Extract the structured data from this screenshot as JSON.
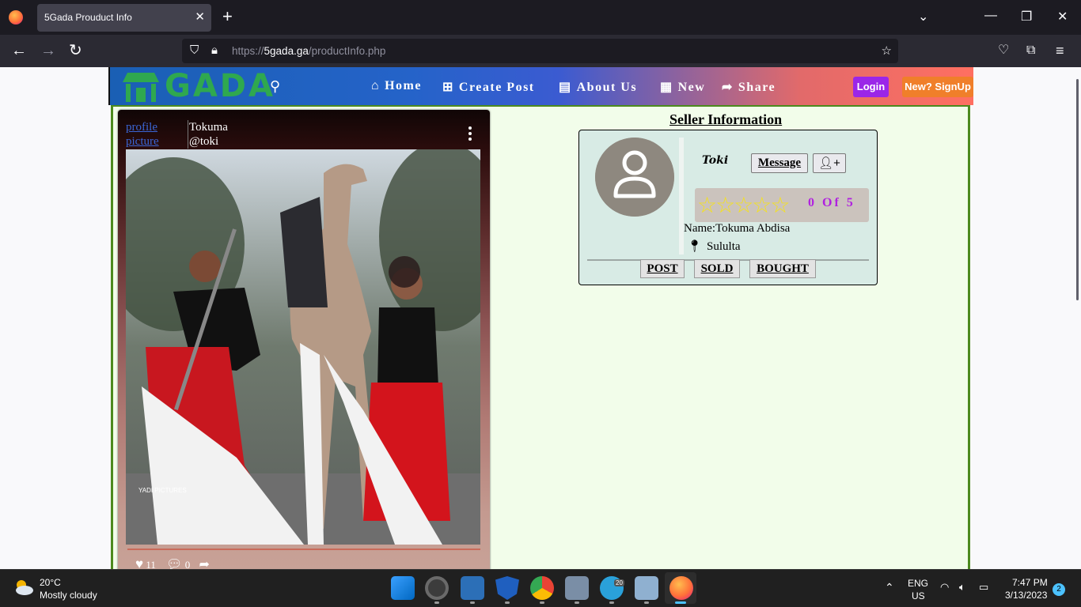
{
  "browser": {
    "tab_title": "5Gada Prouduct Info",
    "url_prefix": "https://",
    "url_domain": "5gada.ga",
    "url_path": "/productInfo.php"
  },
  "site": {
    "logo_text": "GADA",
    "nav": [
      {
        "label": "Home"
      },
      {
        "label": "Create Post"
      },
      {
        "label": "About Us"
      },
      {
        "label": "New"
      },
      {
        "label": "Share"
      }
    ],
    "login_label": "Login",
    "signup_label": "New? SignUp",
    "colors": {
      "logo_green": "#2fa84f",
      "login_purple": "#9b26e8",
      "signup_orange": "#f07f2a",
      "page_green": "#f2fdea"
    }
  },
  "post": {
    "profile_picture_alt": "profile picture",
    "author_name": "Tokuma",
    "author_handle": "@toki",
    "photo_watermark": "YADI PICTURES",
    "likes": "11",
    "comments": "0"
  },
  "seller": {
    "section_title": "Seller Information",
    "handle": "Toki",
    "message_label": "Message",
    "rating_text": "0  Of  5",
    "rating_value": 0,
    "rating_max": 5,
    "name_line": "Name:Tokuma Abdisa",
    "location": "Sululta",
    "tabs": [
      {
        "label": "POST"
      },
      {
        "label": "SOLD"
      },
      {
        "label": "BOUGHT"
      }
    ]
  },
  "taskbar": {
    "temperature": "20°C",
    "weather": "Mostly cloudy",
    "telegram_badge": "20",
    "lang_line1": "ENG",
    "lang_line2": "US",
    "time": "7:47 PM",
    "date": "3/13/2023",
    "notifications": "2"
  }
}
